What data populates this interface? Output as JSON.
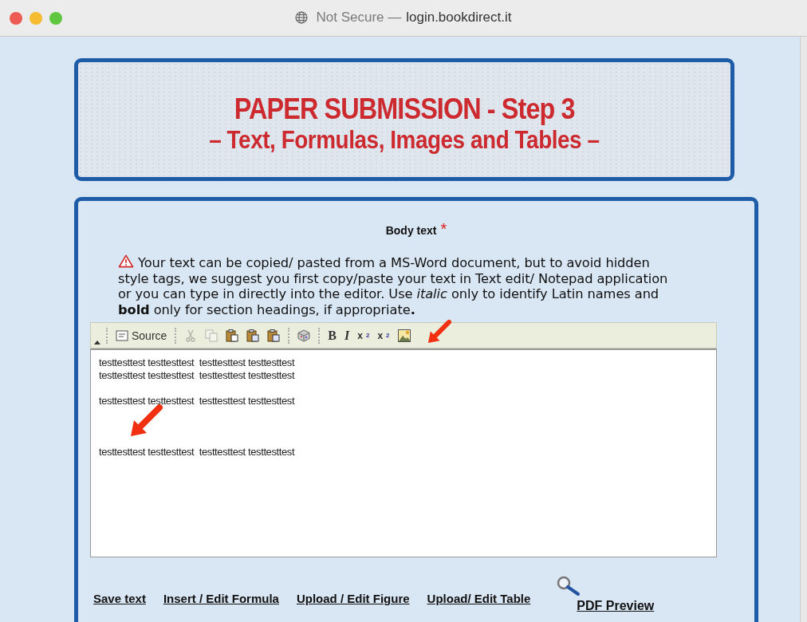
{
  "browser": {
    "security": "Not Secure —",
    "domain": "login.bookdirect.it"
  },
  "header": {
    "title": "PAPER SUBMISSION - Step 3",
    "subtitle": "– Text, Formulas,  Images and Tables –"
  },
  "section": {
    "label": "Body text",
    "required_mark": "*"
  },
  "notice": "Your text can be copied/ pasted from a MS-Word document, but to avoid hidden style tags, we suggest you first copy/paste your text in Text edit/ Notepad application or you can type in directly into the editor. Use *italic* only to identify Latin names and **bold** only for section headings, if appropriate**.**",
  "toolbar": [
    {
      "kind": "source",
      "label": "Source",
      "disabled": false
    },
    {
      "kind": "sep"
    },
    {
      "kind": "cut",
      "disabled": true
    },
    {
      "kind": "copy",
      "disabled": true
    },
    {
      "kind": "paste",
      "disabled": false
    },
    {
      "kind": "paste-text",
      "disabled": false
    },
    {
      "kind": "paste-word",
      "disabled": false
    },
    {
      "kind": "sep"
    },
    {
      "kind": "cube",
      "disabled": false
    },
    {
      "kind": "sep"
    },
    {
      "kind": "bold",
      "label": "B",
      "disabled": false
    },
    {
      "kind": "italic",
      "label": "I",
      "disabled": false
    },
    {
      "kind": "subscript",
      "label": "x",
      "index": "2",
      "disabled": false
    },
    {
      "kind": "superscript",
      "label": "x",
      "index": "2",
      "disabled": false
    },
    {
      "kind": "image",
      "disabled": false
    }
  ],
  "editor_lines": [
    {
      "kind": "text",
      "text": "testtesttest testtesttest  testtesttest testtesttest"
    },
    {
      "kind": "text",
      "text": "testtesttest testtesttest  testtesttest testtesttest"
    },
    {
      "kind": "blank"
    },
    {
      "kind": "text",
      "text": "testtesttest testtesttest  testtesttest testtesttest"
    },
    {
      "kind": "blank"
    },
    {
      "kind": "blank"
    },
    {
      "kind": "blank"
    },
    {
      "kind": "text",
      "text": "testtesttest testtesttest  testtesttest testtesttest"
    }
  ],
  "links": [
    {
      "kind": "plain",
      "label": "Save text"
    },
    {
      "kind": "plain",
      "label": "Insert / Edit Formula"
    },
    {
      "kind": "plain",
      "label": "Upload / Edit Figure"
    },
    {
      "kind": "plain",
      "label": "Upload/ Edit Table"
    },
    {
      "kind": "preview",
      "label": "PDF Preview"
    }
  ]
}
